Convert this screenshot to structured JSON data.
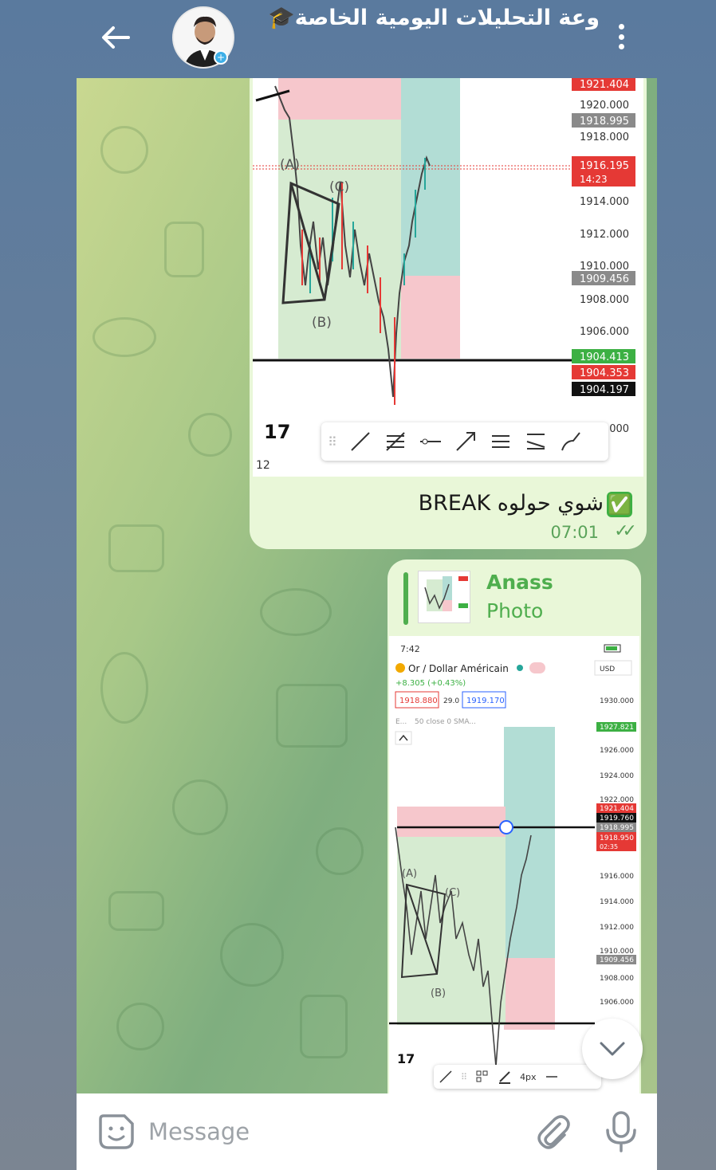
{
  "header": {
    "title": "وعة التحليلات اليومية الخاصة",
    "back_label": "back",
    "menu_label": "more options"
  },
  "colors": {
    "header_bg": "#5a7a9e",
    "bubble_bg": "#e9f7d8",
    "accent_green": "#4fae4e",
    "price_red": "#e53935",
    "price_green": "#3cb043"
  },
  "message1": {
    "text": "شوي حولوه BREAK",
    "emoji": "✅",
    "time": "07:01",
    "status": "read"
  },
  "message1_chart": {
    "price_labels": [
      "1921.404",
      "1920.000",
      "1918.995",
      "1918.000",
      "1916.195",
      "14:23",
      "1914.000",
      "1912.000",
      "1910.000",
      "1909.456",
      "1908.000",
      "1906.000",
      "1904.413",
      "1904.353",
      "1904.197",
      "1900.000"
    ],
    "wave_labels": [
      "(A)",
      "(B)",
      "(C)"
    ],
    "bottom_label": "12",
    "logo": "17"
  },
  "message2": {
    "reply_name": "Anass",
    "reply_type": "Photo"
  },
  "message2_chart": {
    "status_time": "7:42",
    "symbol": "Or / Dollar Américain",
    "change": "+8.305 (+0.43%)",
    "bid": "1918.880",
    "spread": "29.0",
    "ask": "1919.170",
    "indicator": "50 close 0 SMA...",
    "indicator_prefix": "E...",
    "currency": "USD",
    "price_labels": [
      "1930.000",
      "1927.821",
      "1926.000",
      "1924.000",
      "1922.000",
      "1921.404",
      "1919.760",
      "1918.995",
      "1918.950",
      "02:35",
      "1916.000",
      "1914.000",
      "1912.000",
      "1910.000",
      "1909.456",
      "1908.000",
      "1906.000"
    ],
    "wave_labels": [
      "(A)",
      "(B)",
      "(C)"
    ],
    "toolbar_size": "4px",
    "logo": "17"
  },
  "input": {
    "placeholder": "Message"
  }
}
